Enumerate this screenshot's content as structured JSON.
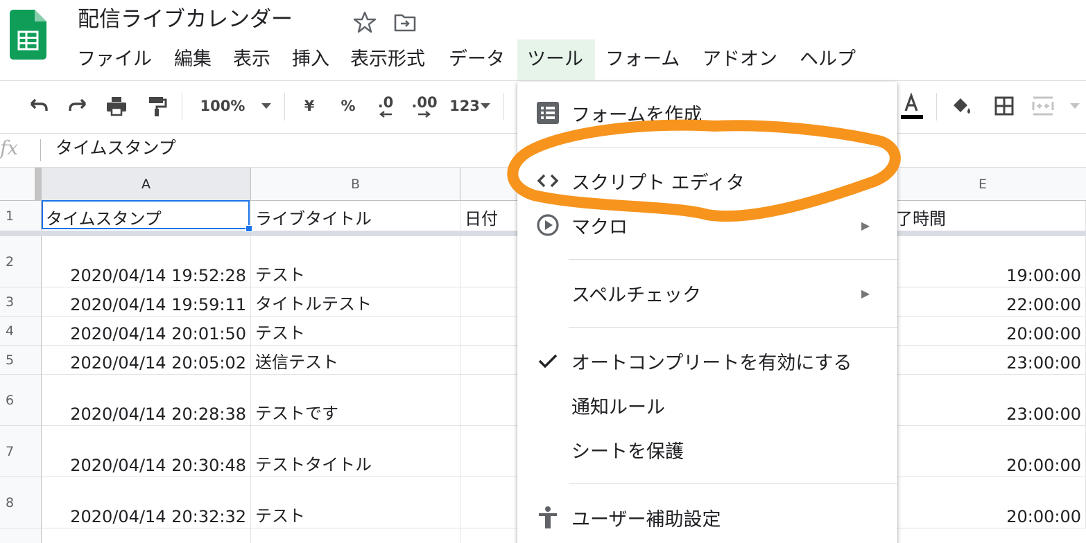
{
  "app": {
    "doc_title": "配信ライブカレンダー",
    "logo_icon": "sheets-logo-icon",
    "star_icon": "star-icon",
    "move_icon": "move-to-folder-icon"
  },
  "menubar": {
    "items": [
      "ファイル",
      "編集",
      "表示",
      "挿入",
      "表示形式",
      "データ",
      "ツール",
      "フォーム",
      "アドオン",
      "ヘルプ"
    ],
    "active": "ツール"
  },
  "toolbar": {
    "zoom": "100%",
    "currency": "¥",
    "percent": "%",
    "decrease_decimal": ".0",
    "increase_decimal": ".00",
    "number_format": "123"
  },
  "formula_bar": {
    "fx": "fx",
    "value": "タイムスタンプ"
  },
  "grid": {
    "columns": [
      "A",
      "B",
      "E"
    ],
    "rows": [
      "1",
      "2",
      "3",
      "4",
      "5",
      "6",
      "7",
      "8"
    ],
    "header_row": {
      "a": "タイムスタンプ",
      "b": "ライブタイトル",
      "c": "日付",
      "e": "終了時間"
    },
    "data": [
      {
        "a": "2020/04/14 19:52:28",
        "b": "テスト",
        "e": "19:00:00"
      },
      {
        "a": "2020/04/14 19:59:11",
        "b": "タイトルテスト",
        "e": "22:00:00"
      },
      {
        "a": "2020/04/14 20:01:50",
        "b": "テスト",
        "e": "20:00:00"
      },
      {
        "a": "2020/04/14 20:05:02",
        "b": "送信テスト",
        "e": "23:00:00"
      },
      {
        "a": "2020/04/14 20:28:38",
        "b": "テストです",
        "e": "23:00:00"
      },
      {
        "a": "2020/04/14 20:30:48",
        "b": "テストタイトル",
        "e": "20:00:00"
      },
      {
        "a": "2020/04/14 20:32:32",
        "b": "テスト",
        "e": "20:00:00"
      }
    ]
  },
  "tools_menu": {
    "create_form": "フォームを作成",
    "script_editor": "スクリプト エディタ",
    "macro": "マクロ",
    "spell_check": "スペルチェック",
    "autocomplete": "オートコンプリートを有効にする",
    "notification_rules": "通知ルール",
    "protect_sheet": "シートを保護",
    "accessibility": "ユーザー補助設定"
  },
  "colors": {
    "sheets_green": "#0f9d58",
    "selection_blue": "#1a73e8",
    "highlight_orange": "#f7941d"
  }
}
